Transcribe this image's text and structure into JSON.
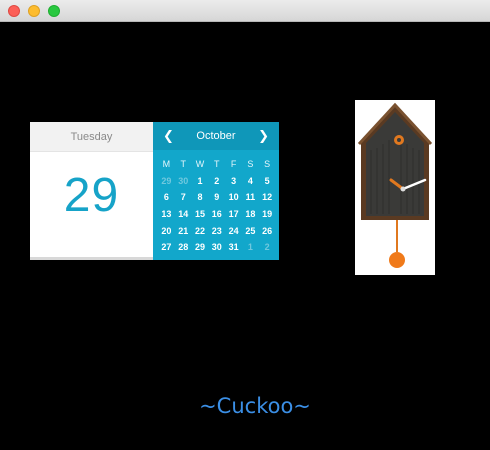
{
  "window": {
    "controls": {
      "close_color": "#fc5f57",
      "minimize_color": "#fdbc2e",
      "maximize_color": "#29c840"
    }
  },
  "calendar": {
    "day_name": "Tuesday",
    "date": "29",
    "month": "October",
    "prev_icon": "chevron-left-icon",
    "next_icon": "chevron-right-icon",
    "weekdays": [
      "M",
      "T",
      "W",
      "T",
      "F",
      "S",
      "S"
    ],
    "days": [
      {
        "n": "29",
        "muted": true
      },
      {
        "n": "30",
        "muted": true
      },
      {
        "n": "1"
      },
      {
        "n": "2"
      },
      {
        "n": "3"
      },
      {
        "n": "4"
      },
      {
        "n": "5"
      },
      {
        "n": "6"
      },
      {
        "n": "7"
      },
      {
        "n": "8"
      },
      {
        "n": "9"
      },
      {
        "n": "10"
      },
      {
        "n": "11"
      },
      {
        "n": "12"
      },
      {
        "n": "13"
      },
      {
        "n": "14"
      },
      {
        "n": "15"
      },
      {
        "n": "16"
      },
      {
        "n": "17"
      },
      {
        "n": "18"
      },
      {
        "n": "19"
      },
      {
        "n": "20"
      },
      {
        "n": "21"
      },
      {
        "n": "22"
      },
      {
        "n": "23"
      },
      {
        "n": "24"
      },
      {
        "n": "25"
      },
      {
        "n": "26"
      },
      {
        "n": "27"
      },
      {
        "n": "28"
      },
      {
        "n": "29"
      },
      {
        "n": "30"
      },
      {
        "n": "31"
      },
      {
        "n": "1",
        "muted": true
      },
      {
        "n": "2",
        "muted": true
      }
    ],
    "accent": "#12a7cb"
  },
  "clock_image": {
    "icon": "cuckoo-clock-icon"
  },
  "caption": "~Cuckoo~"
}
